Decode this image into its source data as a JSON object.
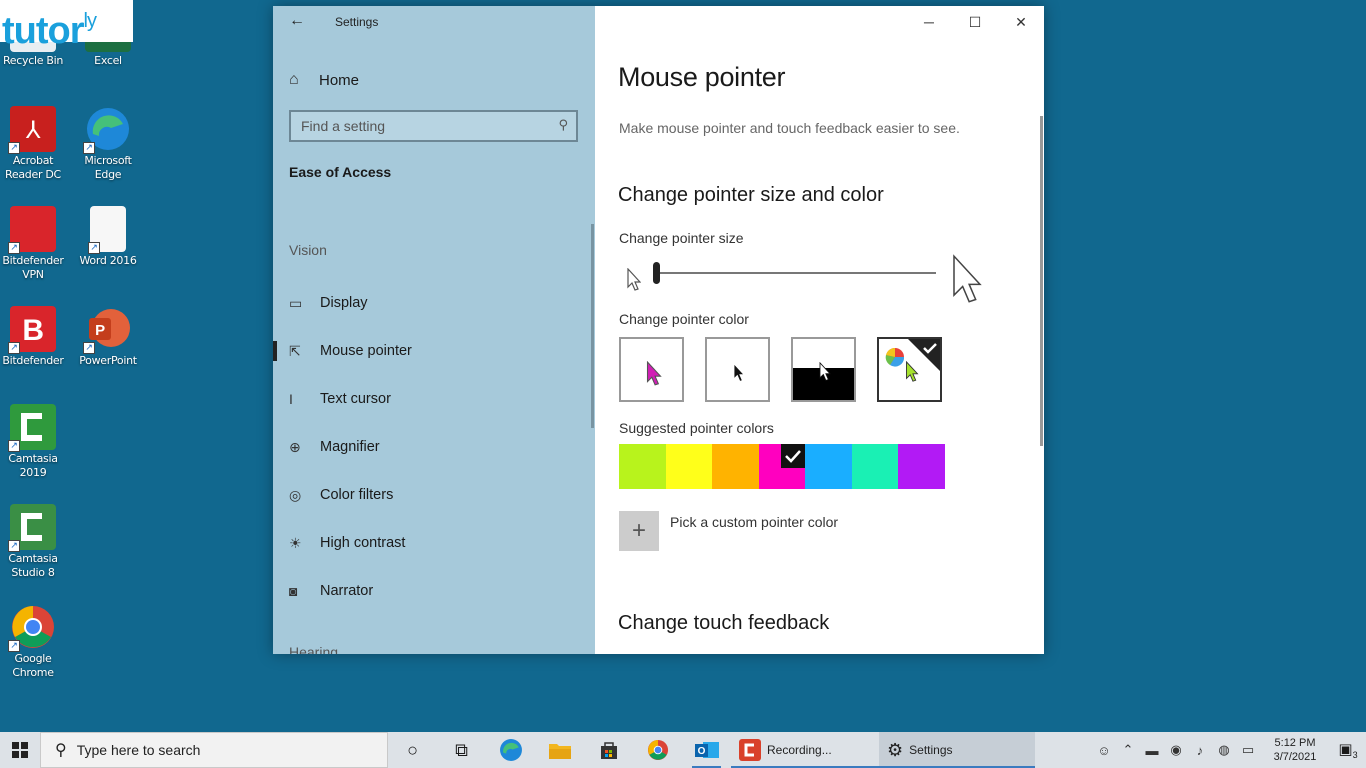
{
  "branding": {
    "logo_text": "tutor",
    "logo_sup": "ly"
  },
  "desktop": {
    "icons": [
      {
        "label": "Recycle Bin"
      },
      {
        "label": "Excel"
      },
      {
        "label": "Acrobat Reader DC"
      },
      {
        "label": "Microsoft Edge"
      },
      {
        "label": "Bitdefender VPN"
      },
      {
        "label": "Word 2016"
      },
      {
        "label": "Bitdefender"
      },
      {
        "label": "PowerPoint"
      },
      {
        "label": "Camtasia 2019"
      },
      {
        "label": "Camtasia Studio 8"
      },
      {
        "label": "Google Chrome"
      }
    ]
  },
  "window": {
    "app_title": "Settings",
    "nav": {
      "home_label": "Home",
      "search_placeholder": "Find a setting",
      "section": "Ease of Access",
      "group_vision": "Vision",
      "items": [
        {
          "label": "Display",
          "icon": "monitor-icon",
          "active": false
        },
        {
          "label": "Mouse pointer",
          "icon": "mouse-pointer-icon",
          "active": true
        },
        {
          "label": "Text cursor",
          "icon": "text-cursor-icon",
          "active": false
        },
        {
          "label": "Magnifier",
          "icon": "magnifier-icon",
          "active": false
        },
        {
          "label": "Color filters",
          "icon": "color-filter-icon",
          "active": false
        },
        {
          "label": "High contrast",
          "icon": "high-contrast-icon",
          "active": false
        },
        {
          "label": "Narrator",
          "icon": "narrator-icon",
          "active": false
        }
      ],
      "group_hearing": "Hearing"
    },
    "content": {
      "page_title": "Mouse pointer",
      "description": "Make mouse pointer and touch feedback easier to see.",
      "size_color_heading": "Change pointer size and color",
      "size_label": "Change pointer size",
      "size_slider_value": 1,
      "color_label": "Change pointer color",
      "color_options": [
        {
          "name": "white",
          "selected": false
        },
        {
          "name": "black",
          "selected": false
        },
        {
          "name": "inverted",
          "selected": false
        },
        {
          "name": "custom",
          "selected": true
        }
      ],
      "suggested_label": "Suggested pointer colors",
      "suggested_colors": [
        "#b8f31c",
        "#ffff1a",
        "#ffb300",
        "#ff00bf",
        "#1aaeff",
        "#1af0b4",
        "#b21af5"
      ],
      "suggested_selected_index": 3,
      "custom_label": "Pick a custom pointer color",
      "touch_heading": "Change touch feedback"
    }
  },
  "taskbar": {
    "search_placeholder": "Type here to search",
    "recording_label": "Recording...",
    "settings_label": "Settings",
    "time": "5:12 PM",
    "date": "3/7/2021",
    "notification_count": "3"
  }
}
